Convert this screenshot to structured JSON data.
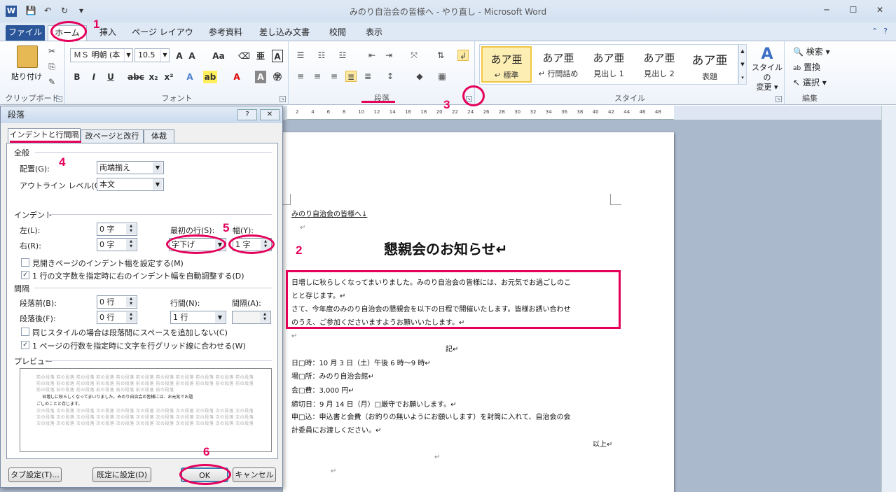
{
  "window": {
    "title": "みのり自治会の皆様へ - やり直し  -  Microsoft Word",
    "logo": "W",
    "qat_save": "💾",
    "qat_undo": "↶",
    "qat_redo": "↻",
    "qat_more": "▾"
  },
  "tabs": [
    "ファイル",
    "ホーム",
    "挿入",
    "ページ レイアウト",
    "参考資料",
    "差し込み文書",
    "校閲",
    "表示"
  ],
  "ribbon": {
    "clipboard": {
      "paste": "貼り付け",
      "label": "クリップボード"
    },
    "font": {
      "name": "ＭＳ 明朝 (本",
      "size": "10.5",
      "label": "フォント"
    },
    "paragraph": {
      "label": "段落"
    },
    "styles": {
      "label": "スタイル",
      "items": [
        {
          "sample": "あア亜",
          "name": "↵ 標準"
        },
        {
          "sample": "あア亜",
          "name": "↵ 行間詰め"
        },
        {
          "sample": "あア亜",
          "name": "見出し 1"
        },
        {
          "sample": "あア亜",
          "name": "見出し 2"
        },
        {
          "sample": "あア亜",
          "name": "表題"
        }
      ],
      "change": "スタイルの\n変更 ▾"
    },
    "editing": {
      "label": "編集",
      "find": "検索 ▾",
      "replace": "置換",
      "select": "選択 ▾"
    }
  },
  "dialog": {
    "title": "段落",
    "help": "?",
    "close": "✕",
    "tabs": [
      "インデントと行間隔",
      "改ページと改行",
      "体裁"
    ],
    "general": {
      "title": "全般",
      "alignment_label": "配置(G):",
      "alignment_value": "両端揃え",
      "outline_label": "アウトライン レベル(O):",
      "outline_value": "本文"
    },
    "indent": {
      "title": "インデント",
      "left_label": "左(L):",
      "left_value": "0 字",
      "right_label": "右(R):",
      "right_value": "0 字",
      "first_line_label": "最初の行(S):",
      "first_line_value": "字下げ",
      "width_label": "幅(Y):",
      "width_value": "1 字",
      "mirror_label": "見開きページのインデント幅を設定する(M)",
      "mirror_checked": false,
      "auto_adjust_label": "1 行の文字数を指定時に右のインデント幅を自動調整する(D)",
      "auto_adjust_checked": true
    },
    "spacing": {
      "title": "間隔",
      "before_label": "段落前(B):",
      "before_value": "0 行",
      "after_label": "段落後(F):",
      "after_value": "0 行",
      "line_label": "行間(N):",
      "line_value": "1 行",
      "at_label": "間隔(A):",
      "at_value": "",
      "no_space_label": "同じスタイルの場合は段落間にスペースを追加しない(C)",
      "no_space_checked": false,
      "grid_label": "1 ページの行数を指定時に文字を行グリッド線に合わせる(W)",
      "grid_checked": true
    },
    "preview": {
      "title": "プレビュー",
      "prev_lines": [
        "前の段落 前の段落 前の段落 前の段落 前の段落 前の段落 前の段落 前の段落 前の段落 前の段落 前の段落",
        "前の段落 前の段落 前の段落 前の段落 前の段落 前の段落 前の段落 前の段落 前の段落 前の段落 前の段落",
        "前の段落 前の段落 前の段落 前の段落 前の段落 前の段落 前の段落"
      ],
      "sample_lines": [
        "日増しに秋らしくなってまいりました。みのり自治会の皆様には、お元気でお過",
        "ごしのことと存じます。"
      ],
      "next_lines": [
        "次の段落 次の段落 次の段落 次の段落 次の段落 次の段落 次の段落 次の段落 次の段落 次の段落 次の段落",
        "次の段落 次の段落 次の段落 次の段落 次の段落 次の段落 次の段落 次の段落 次の段落 次の段落 次の段落",
        "次の段落 次の段落 次の段落 次の段落 次の段落 次の段落 次の段落 次の段落 次の段落 次の段落 次の段落"
      ]
    },
    "buttons": {
      "tabs": "タブ設定(T)...",
      "default": "既定に設定(D)",
      "ok": "OK",
      "cancel": "キャンセル"
    }
  },
  "ruler": [
    "2",
    "4",
    "6",
    "8",
    "10",
    "12",
    "14",
    "16",
    "18",
    "20",
    "22",
    "24",
    "26",
    "28",
    "30",
    "32",
    "34",
    "36",
    "38",
    "40",
    "42",
    "44",
    "46",
    "48"
  ],
  "document": {
    "salutation": "みのり自治会の皆様へ↓",
    "mark1": "↵",
    "title": "懇親会のお知らせ↵",
    "body": [
      "日増しに秋らしくなってまいりました。みのり自治会の皆様には、お元気でお過ごしのこ",
      "とと存じます。↵",
      "さて、今年度のみのり自治会の懇親会を以下の日程で開催いたします。皆様お誘い合わせ",
      "のうえ、ご参加くださいますようお願いいたします。↵"
    ],
    "mark2": "↵",
    "ki": "記↵",
    "items": [
      "日□時：10 月 3 日（土）午後 6 時～9 時↵",
      "場□所：みのり自治会館↵",
      "会□費：3,000 円↵",
      "締切日：9 月 14 日（月）□厳守でお願いします。↵",
      "申□込：申込書と会費（お釣りの無いようにお願いします）を封筒に入れて、自治会の会",
      "計委員にお渡しください。↵"
    ],
    "ijo": "以上↵",
    "mark3": "↵",
    "mark4": "↵"
  },
  "annotations": [
    "1",
    "2",
    "3",
    "4",
    "5",
    "6"
  ],
  "colors": {
    "accent": "#e5005a",
    "file_tab": "#2a5699"
  }
}
